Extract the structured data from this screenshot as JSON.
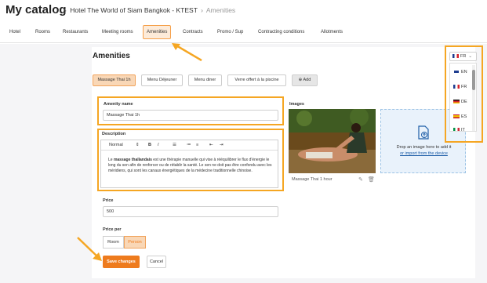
{
  "header": {
    "title": "My catalog",
    "breadcrumb": {
      "hotel": "Hotel The World of Siam Bangkok - KTEST",
      "section": "Amenities"
    }
  },
  "tabs": [
    "Hotel",
    "Rooms",
    "Restaurants",
    "Meeting rooms",
    "Amenities",
    "Contracts",
    "Promo / Sup",
    "Contracting conditions",
    "Allotments"
  ],
  "active_tab": "Amenities",
  "page": {
    "heading": "Amenities",
    "chips": [
      "Massage Thai 1h",
      "Menu Déjeuner",
      "Menu diner",
      "Verre offert à la piscine"
    ],
    "add_label": "Add"
  },
  "form": {
    "amenity_name_label": "Amenity name",
    "amenity_name_value": "Massage Thai 1h",
    "description_label": "Description",
    "toolbar": {
      "style": "Normal",
      "bold": "B",
      "italic": "I"
    },
    "description_bold": "massage thaïlandais",
    "description_pre": "Le ",
    "description_post": " est une thérapie manuelle qui vise à rééquilibrer le flux d'énergie le long du sen afin de renforcer ou de rétablir la santé. Le sen ne doit pas être confondu avec les méridiens, qui sont les canaux énergétiques de la médecine traditionnelle chinoise.",
    "price_label": "Price",
    "price_value": "500",
    "price_per_label": "Price per",
    "price_per_options": [
      "Room",
      "Person"
    ],
    "price_per_selected": "Person",
    "save_label": "Save changes",
    "cancel_label": "Cancel"
  },
  "images": {
    "label": "Images",
    "caption": "Massage Thai 1 hour",
    "dropzone_text": "Drop an image here to add it",
    "dropzone_link": "or import from the device"
  },
  "language": {
    "current": "FR",
    "options": [
      {
        "code": "EN",
        "flag": "uk"
      },
      {
        "code": "FR",
        "flag": "fr"
      },
      {
        "code": "DE",
        "flag": "de"
      },
      {
        "code": "ES",
        "flag": "es"
      },
      {
        "code": "IT",
        "flag": "it"
      }
    ]
  },
  "colors": {
    "accent": "#ee7b1d",
    "highlight": "#f5a623",
    "link": "#1f5fa8"
  }
}
